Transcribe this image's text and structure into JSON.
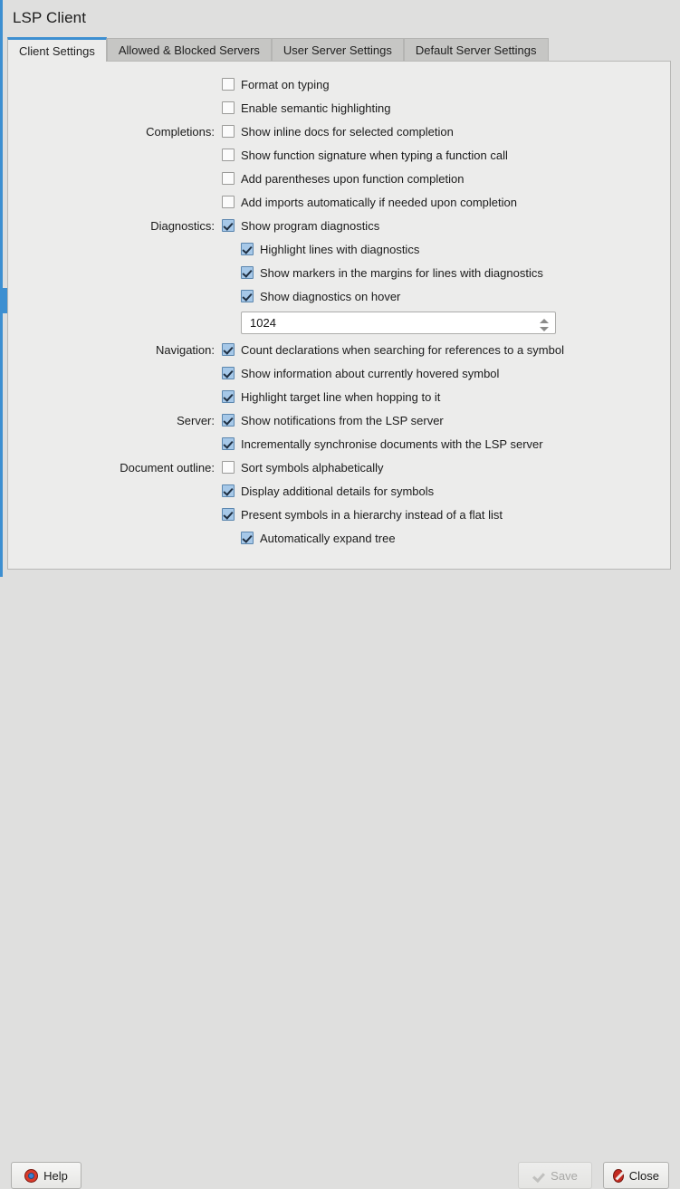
{
  "dialog": {
    "title": "LSP Client"
  },
  "tabs": [
    {
      "label": "Client Settings",
      "active": true
    },
    {
      "label": "Allowed & Blocked Servers",
      "active": false
    },
    {
      "label": "User Server Settings",
      "active": false
    },
    {
      "label": "Default Server Settings",
      "active": false
    }
  ],
  "settings": {
    "rows": [
      {
        "label": "",
        "text": "Format on typing",
        "checked": false,
        "indent": 0
      },
      {
        "label": "",
        "text": "Enable semantic highlighting",
        "checked": false,
        "indent": 0
      },
      {
        "label": "Completions:",
        "text": "Show inline docs for selected completion",
        "checked": false,
        "indent": 0
      },
      {
        "label": "",
        "text": "Show function signature when typing a function call",
        "checked": false,
        "indent": 0
      },
      {
        "label": "",
        "text": "Add parentheses upon function completion",
        "checked": false,
        "indent": 0
      },
      {
        "label": "",
        "text": "Add imports automatically if needed upon completion",
        "checked": false,
        "indent": 0
      },
      {
        "label": "Diagnostics:",
        "text": "Show program diagnostics",
        "checked": true,
        "indent": 0
      },
      {
        "label": "",
        "text": "Highlight lines with diagnostics",
        "checked": true,
        "indent": 1
      },
      {
        "label": "",
        "text": "Show markers in the margins for lines with diagnostics",
        "checked": true,
        "indent": 1
      },
      {
        "label": "",
        "text": "Show diagnostics on hover",
        "checked": true,
        "indent": 1
      }
    ],
    "rows_after_spin": [
      {
        "label": "Navigation:",
        "text": "Count declarations when searching for references to a symbol",
        "checked": true,
        "indent": 0
      },
      {
        "label": "",
        "text": "Show information about currently hovered symbol",
        "checked": true,
        "indent": 0
      },
      {
        "label": "",
        "text": "Highlight target line when hopping to it",
        "checked": true,
        "indent": 0
      },
      {
        "label": "Server:",
        "text": "Show notifications from the LSP server",
        "checked": true,
        "indent": 0
      },
      {
        "label": "",
        "text": "Incrementally synchronise documents with the LSP server",
        "checked": true,
        "indent": 0
      },
      {
        "label": "Document outline:",
        "text": "Sort symbols alphabetically",
        "checked": false,
        "indent": 0
      },
      {
        "label": "",
        "text": "Display additional details for symbols",
        "checked": true,
        "indent": 0
      },
      {
        "label": "",
        "text": "Present symbols in a hierarchy instead of a flat list",
        "checked": true,
        "indent": 0
      },
      {
        "label": "",
        "text": "Automatically expand tree",
        "checked": true,
        "indent": 1
      }
    ],
    "spinbox": {
      "value": "1024"
    }
  },
  "buttons": {
    "help": "Help",
    "save": "Save",
    "close": "Close"
  },
  "colors": {
    "accent": "#3d8fd1",
    "checkbox_checked_fill": "#a6c8e8",
    "checkbox_checked_border": "#5b86ae",
    "panel_bg": "#ececeb",
    "window_bg": "#dfdfde",
    "tab_inactive_bg": "#c6c6c4",
    "close_icon": "#c32a20",
    "help_icon_outer": "#d93a2b",
    "help_icon_inner": "#3d7fd1"
  }
}
